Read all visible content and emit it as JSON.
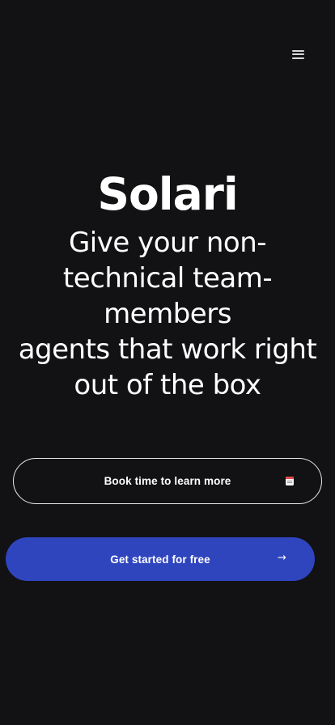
{
  "header": {
    "menu_icon": "hamburger-menu-icon"
  },
  "hero": {
    "title": "Solari",
    "subtitle_lines": [
      "Give your non-",
      "technical team-",
      "members",
      "agents that work right",
      "out of the box"
    ]
  },
  "actions": {
    "book": {
      "label": "Book time to learn more",
      "icon": "calendar-icon"
    },
    "start": {
      "label": "Get started for free",
      "icon": "arrow-right-icon",
      "arrow": "→"
    }
  },
  "colors": {
    "background": "#121113",
    "primary_button": "#2f45be",
    "text": "#ffffff"
  }
}
